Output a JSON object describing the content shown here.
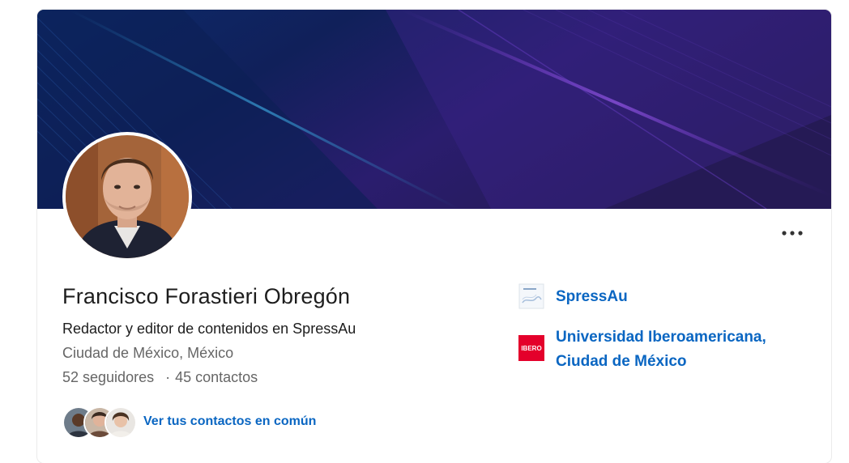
{
  "profile": {
    "name": "Francisco Forastieri Obregón",
    "headline": "Redactor y editor de contenidos en SpressAu",
    "location": "Ciudad de México, México",
    "followers": "52 seguidores",
    "separator": "·",
    "connections": "45 contactos",
    "mutual_label": "Ver tus contactos en común"
  },
  "organizations": [
    {
      "name": "SpressAu",
      "logo": "spressau-logo"
    },
    {
      "name_line1": "Universidad Iberoamericana,",
      "name_line2": "Ciudad de México",
      "logo": "ibero-logo",
      "logo_text": "IBERO"
    }
  ],
  "colors": {
    "link": "#0a66c2",
    "banner_dark": "#0f1a4a",
    "banner_purple": "#4b2a8f",
    "ibero_red": "#e4002b"
  },
  "icons": {
    "more": "more-horizontal-icon"
  }
}
